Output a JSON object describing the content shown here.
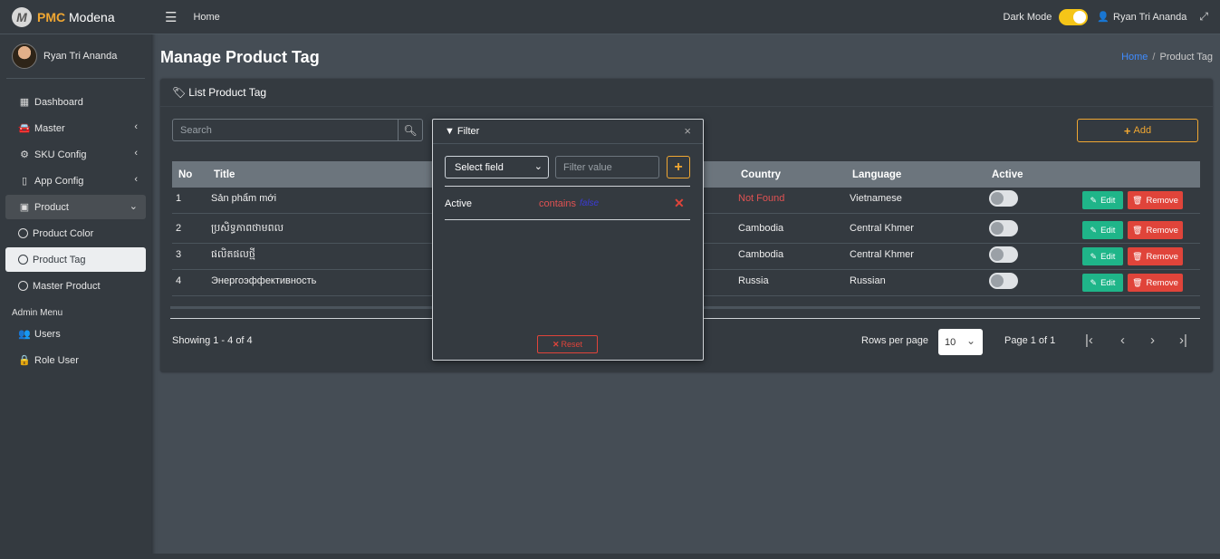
{
  "brand": {
    "logo_letter": "M",
    "name_bold": "PMC",
    "name_rest": " Modena"
  },
  "sidebar": {
    "user_name": "Ryan Tri Ananda",
    "items": [
      {
        "label": "Dashboard",
        "icon": "grid-icon"
      },
      {
        "label": "Master",
        "icon": "car-icon"
      },
      {
        "label": "SKU Config",
        "icon": "gear-icon"
      },
      {
        "label": "App Config",
        "icon": "mobile-icon"
      },
      {
        "label": "Product",
        "icon": "briefcase-icon"
      }
    ],
    "sub_items": [
      {
        "label": "Product Color"
      },
      {
        "label": "Product Tag"
      },
      {
        "label": "Master Product"
      }
    ],
    "admin_header": "Admin Menu",
    "admin_items": [
      {
        "label": "Users",
        "icon": "users-icon"
      },
      {
        "label": "Role User",
        "icon": "lock-icon"
      }
    ]
  },
  "topbar": {
    "home": "Home",
    "dark_mode_label": "Dark Mode",
    "dark_mode_on": true,
    "user_name": "Ryan Tri Ananda"
  },
  "page": {
    "title": "Manage Product Tag",
    "breadcrumb": {
      "home": "Home",
      "separator": "/",
      "current": "Product Tag"
    }
  },
  "card": {
    "title": "List Product Tag",
    "search_placeholder": "Search",
    "add_label": "Add"
  },
  "table": {
    "headers": {
      "no": "No",
      "title": "Title",
      "country": "Country",
      "language": "Language",
      "active": "Active"
    },
    "rows": [
      {
        "no": "1",
        "title": "Sản phẩm mới",
        "country": "Not Found",
        "language": "Vietnamese",
        "active": false
      },
      {
        "no": "2",
        "title": "ប្រសិទ្ធភាពថាមពល",
        "country": "Cambodia",
        "language": "Central Khmer",
        "active": false
      },
      {
        "no": "3",
        "title": "ផលិតផលថ្មី",
        "country": "Cambodia",
        "language": "Central Khmer",
        "active": false
      },
      {
        "no": "4",
        "title": "Энергоэффективность",
        "country": "Russia",
        "language": "Russian",
        "active": false
      }
    ],
    "edit_label": "Edit",
    "remove_label": "Remove"
  },
  "pagination": {
    "showing": "Showing 1 - 4 of 4",
    "rows_per_page_label": "Rows per page",
    "rows_per_page_value": "10",
    "page_info": "Page 1 of 1"
  },
  "filter": {
    "title": "Filter",
    "select_field": "Select field",
    "value_placeholder": "Filter value",
    "rule": {
      "field": "Active",
      "operator": "contains",
      "value": "false"
    },
    "reset_label": "Reset"
  },
  "colors": {
    "accent": "#f0a732",
    "danger": "#e0443a",
    "success": "#1fb589",
    "link": "#3f8cff"
  }
}
